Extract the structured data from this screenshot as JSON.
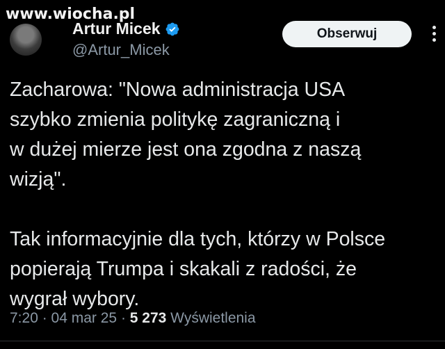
{
  "watermark": "www.wiocha.pl",
  "author": {
    "name": "Artur Micek",
    "handle": "@Artur_Micek",
    "verified_color": "#1d9bf0"
  },
  "follow_label": "Obserwuj",
  "tweet": {
    "lines_p1": [
      "Zacharowa: \"Nowa administracja USA",
      "szybko zmienia politykę zagraniczną i",
      "w dużej mierze jest ona zgodna z naszą",
      "wizją\"."
    ],
    "lines_p2": [
      "Tak informacyjnie dla tych, którzy w Polsce",
      "popierają Trumpa i skakali z radości, że",
      "wygrał wybory."
    ]
  },
  "meta": {
    "time": "7:20",
    "sep1": " · ",
    "date": "04 mar 25",
    "sep2": " · ",
    "views_count": "5 273",
    "views_label": " Wyświetlenia"
  },
  "icons": {
    "verified": "verified-badge-icon",
    "more": "more-dots-icon"
  }
}
